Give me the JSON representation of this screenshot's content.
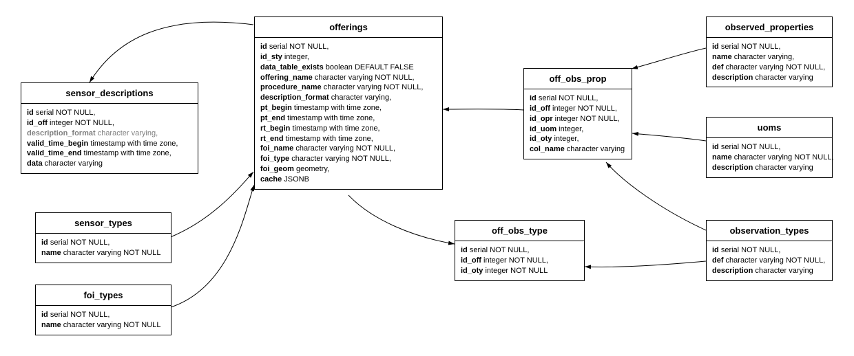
{
  "diagram_type": "entity-relationship",
  "entities": {
    "sensor_descriptions": {
      "title": "sensor_descriptions",
      "columns": [
        {
          "name": "id",
          "type": "serial NOT NULL,"
        },
        {
          "name": "id_off",
          "type": "integer NOT NULL,"
        },
        {
          "name": "description_format",
          "type": "character varying,",
          "muted": true
        },
        {
          "name": "valid_time_begin",
          "type": "timestamp with time zone,"
        },
        {
          "name": "valid_time_end",
          "type": "timestamp with time zone,"
        },
        {
          "name": "data",
          "type": "character varying"
        }
      ]
    },
    "sensor_types": {
      "title": "sensor_types",
      "columns": [
        {
          "name": "id",
          "type": "serial NOT NULL,"
        },
        {
          "name": "name",
          "type": "character varying NOT NULL"
        }
      ]
    },
    "foi_types": {
      "title": "foi_types",
      "columns": [
        {
          "name": "id",
          "type": "serial NOT NULL,"
        },
        {
          "name": "name",
          "type": "character varying NOT NULL"
        }
      ]
    },
    "offerings": {
      "title": "offerings",
      "columns": [
        {
          "name": "id",
          "type": "serial NOT NULL,"
        },
        {
          "name": "id_sty",
          "type": "integer,"
        },
        {
          "name": "data_table_exists",
          "type": "boolean DEFAULT FALSE"
        },
        {
          "name": "offering_name",
          "type": "character varying NOT NULL,"
        },
        {
          "name": "procedure_name",
          "type": "character varying NOT NULL,"
        },
        {
          "name": "description_format",
          "type": "character varying,"
        },
        {
          "name": "pt_begin",
          "type": "timestamp with time zone,"
        },
        {
          "name": "pt_end",
          "type": "timestamp with time zone,"
        },
        {
          "name": "rt_begin",
          "type": "timestamp with time zone,"
        },
        {
          "name": "rt_end",
          "type": "timestamp with time zone,"
        },
        {
          "name": "foi_name",
          "type": "character varying NOT NULL,"
        },
        {
          "name": "foi_type",
          "type": "character varying NOT NULL,"
        },
        {
          "name": "foi_geom",
          "type": "geometry,"
        },
        {
          "name": "cache",
          "type": "JSONB"
        }
      ]
    },
    "off_obs_prop": {
      "title": "off_obs_prop",
      "columns": [
        {
          "name": "id",
          "type": "serial NOT NULL,"
        },
        {
          "name": "id_off",
          "type": "integer NOT NULL,"
        },
        {
          "name": "id_opr",
          "type": "integer NOT NULL,"
        },
        {
          "name": "id_uom",
          "type": "integer,"
        },
        {
          "name": "id_oty",
          "type": "integer,"
        },
        {
          "name": "col_name",
          "type": "character varying"
        }
      ]
    },
    "off_obs_type": {
      "title": "off_obs_type",
      "columns": [
        {
          "name": "id",
          "type": "serial NOT NULL,"
        },
        {
          "name": "id_off",
          "type": "integer NOT NULL,"
        },
        {
          "name": "id_oty",
          "type": "integer NOT NULL"
        }
      ]
    },
    "observed_properties": {
      "title": "observed_properties",
      "columns": [
        {
          "name": "id",
          "type": "serial NOT NULL,"
        },
        {
          "name": "name",
          "type": "character varying,"
        },
        {
          "name": "def",
          "type": "character varying NOT NULL,"
        },
        {
          "name": "description",
          "type": "character varying"
        }
      ]
    },
    "uoms": {
      "title": "uoms",
      "columns": [
        {
          "name": "id",
          "type": "serial NOT NULL,"
        },
        {
          "name": "name",
          "type": "character varying NOT NULL,"
        },
        {
          "name": "description",
          "type": "character varying"
        }
      ]
    },
    "observation_types": {
      "title": "observation_types",
      "columns": [
        {
          "name": "id",
          "type": "serial NOT NULL,"
        },
        {
          "name": "def",
          "type": "character varying NOT NULL,"
        },
        {
          "name": "description",
          "type": "character varying"
        }
      ]
    }
  },
  "relationships": [
    {
      "from": "offerings",
      "to": "sensor_descriptions"
    },
    {
      "from": "sensor_types",
      "to": "offerings"
    },
    {
      "from": "foi_types",
      "to": "offerings"
    },
    {
      "from": "offerings",
      "to": "off_obs_type"
    },
    {
      "from": "off_obs_prop",
      "to": "offerings"
    },
    {
      "from": "observed_properties",
      "to": "off_obs_prop"
    },
    {
      "from": "uoms",
      "to": "off_obs_prop"
    },
    {
      "from": "observation_types",
      "to": "off_obs_prop"
    },
    {
      "from": "observation_types",
      "to": "off_obs_type"
    }
  ]
}
